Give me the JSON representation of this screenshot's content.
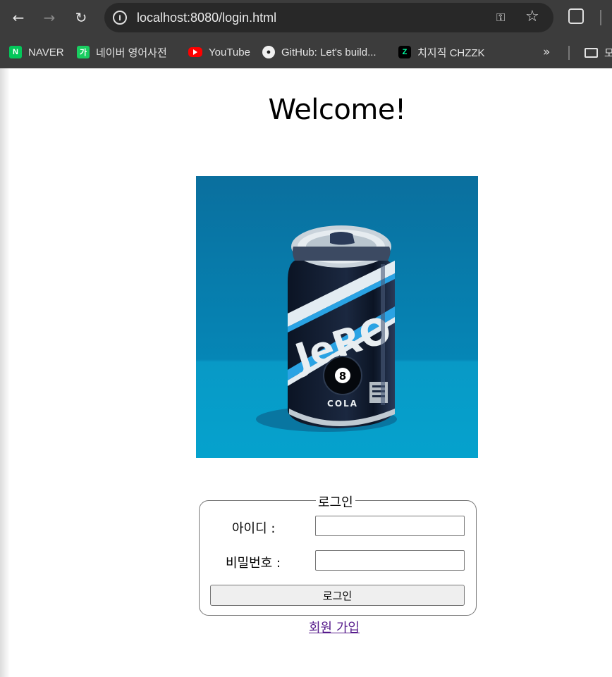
{
  "browser": {
    "url": "localhost:8080/login.html",
    "bookmarks": [
      {
        "label": "NAVER",
        "icon": "naver-icon",
        "badge": "N"
      },
      {
        "label": "네이버 영어사전",
        "icon": "naver-dictionary-icon",
        "badge": "가"
      },
      {
        "label": "YouTube",
        "icon": "youtube-icon",
        "badge": ""
      },
      {
        "label": "GitHub: Let's build...",
        "icon": "github-icon",
        "badge": "●"
      },
      {
        "label": "치지직 CHZZK",
        "icon": "chzzk-icon",
        "badge": "Z"
      }
    ],
    "bookmarks_more": "»",
    "bookmarks_folder": "모"
  },
  "page": {
    "title": "Welcome!",
    "hero_image": {
      "brand_text": "JeRO",
      "ball_number": "8",
      "product": "COLA"
    },
    "login": {
      "legend": "로그인",
      "id_label": "아이디 :",
      "id_value": "",
      "password_label": "비밀번호 :",
      "password_value": "",
      "submit_label": "로그인"
    },
    "signup_link": "회원 가입"
  }
}
